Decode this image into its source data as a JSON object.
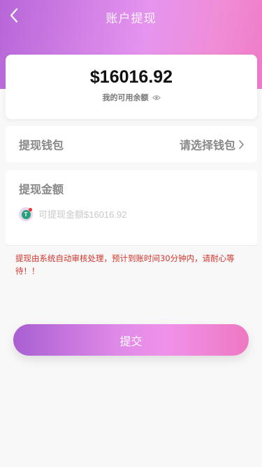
{
  "header": {
    "title": "账户提现",
    "back_icon": "chevron-left-icon"
  },
  "balance": {
    "amount": "$16016.92",
    "label": "我的可用余额",
    "visibility_icon": "eye-icon"
  },
  "wallet": {
    "label": "提现钱包",
    "select_text": "请选择钱包",
    "arrow_icon": "chevron-right-icon"
  },
  "amount": {
    "title": "提现金额",
    "coin_icon": "usdt-icon",
    "placeholder": "可提现金额$16016.92",
    "value": ""
  },
  "notice": "提现由系统自动审核处理，预计到账时间30分钟内，请耐心等待！！",
  "submit_label": "提交",
  "colors": {
    "gradient_start": "#b766d8",
    "gradient_end": "#ef7bc8",
    "notice": "#d0342c"
  }
}
